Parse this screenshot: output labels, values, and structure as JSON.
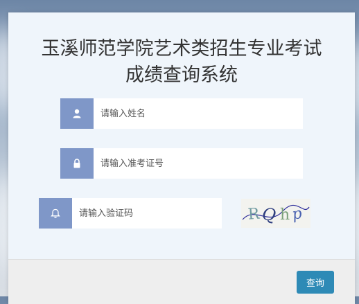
{
  "header": {
    "title_line1": "玉溪师范学院艺术类招生专业考试",
    "title_line2": "成绩查询系统"
  },
  "form": {
    "name_placeholder": "请输入姓名",
    "ticket_placeholder": "请输入准考证号",
    "captcha_placeholder": "请输入验证码",
    "captcha_text": "ROhp"
  },
  "icons": {
    "name": "user-icon",
    "ticket": "lock-icon",
    "captcha": "bell-icon"
  },
  "colors": {
    "icon_bg": "#7f97c8",
    "button_bg": "#2e8ab6",
    "panel_bg": "#eff5fb"
  },
  "footer": {
    "query_label": "查询"
  }
}
